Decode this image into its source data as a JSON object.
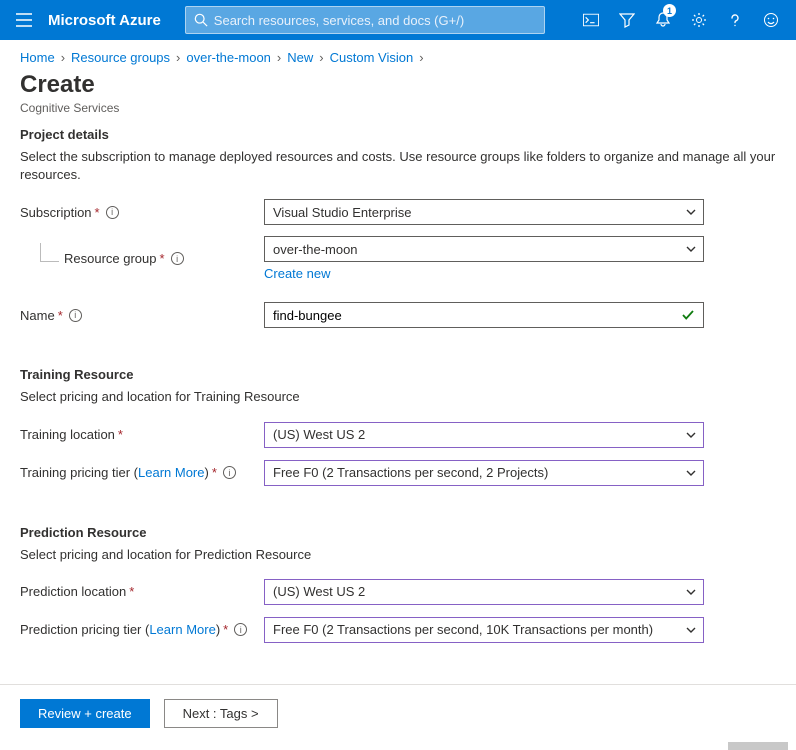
{
  "topbar": {
    "brand": "Microsoft Azure",
    "search_placeholder": "Search resources, services, and docs (G+/)",
    "notification_count": "1"
  },
  "breadcrumb": {
    "items": [
      "Home",
      "Resource groups",
      "over-the-moon",
      "New",
      "Custom Vision"
    ]
  },
  "page": {
    "title": "Create",
    "subtitle": "Cognitive Services"
  },
  "project_details": {
    "heading": "Project details",
    "desc": "Select the subscription to manage deployed resources and costs. Use resource groups like folders to organize and manage all your resources.",
    "subscription_label": "Subscription",
    "subscription_value": "Visual Studio Enterprise",
    "resource_group_label": "Resource group",
    "resource_group_value": "over-the-moon",
    "create_new": "Create new",
    "name_label": "Name",
    "name_value": "find-bungee"
  },
  "training": {
    "heading": "Training Resource",
    "desc": "Select pricing and location for Training Resource",
    "location_label": "Training location",
    "location_value": "(US) West US 2",
    "tier_label_pre": "Training pricing tier (",
    "tier_label_learn": "Learn More",
    "tier_label_post": ")",
    "tier_value": "Free F0 (2 Transactions per second, 2 Projects)"
  },
  "prediction": {
    "heading": "Prediction Resource",
    "desc": "Select pricing and location for Prediction Resource",
    "location_label": "Prediction location",
    "location_value": "(US) West US 2",
    "tier_label_pre": "Prediction pricing tier (",
    "tier_label_learn": "Learn More",
    "tier_label_post": ")",
    "tier_value": "Free F0 (2 Transactions per second, 10K Transactions per month)"
  },
  "footer": {
    "review": "Review + create",
    "next": "Next : Tags >"
  }
}
